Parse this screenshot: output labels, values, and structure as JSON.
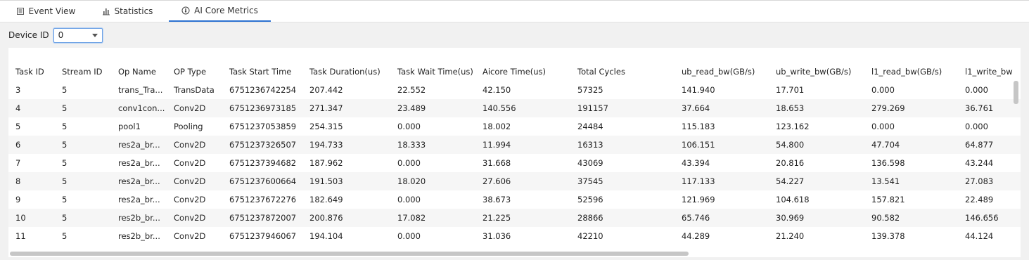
{
  "tabs": [
    {
      "label": "Event View",
      "icon": "list-icon",
      "active": false
    },
    {
      "label": "Statistics",
      "icon": "bar-chart-icon",
      "active": false
    },
    {
      "label": "AI Core Metrics",
      "icon": "gauge-icon",
      "active": true
    }
  ],
  "device": {
    "label": "Device ID",
    "value": "0"
  },
  "table": {
    "columns": [
      "Task ID",
      "Stream ID",
      "Op Name",
      "OP Type",
      "Task Start Time",
      "Task Duration(us)",
      "Task Wait Time(us)",
      "Aicore Time(us)",
      "Total Cycles",
      "ub_read_bw(GB/s)",
      "ub_write_bw(GB/s)",
      "l1_read_bw(GB/s)",
      "l1_write_bw"
    ],
    "rows": [
      [
        "3",
        "5",
        "trans_Tra...",
        "TransData",
        "6751236742254",
        "207.442",
        "22.552",
        "42.150",
        "57325",
        "141.940",
        "17.701",
        "0.000",
        "0.000"
      ],
      [
        "4",
        "5",
        "conv1con...",
        "Conv2D",
        "6751236973185",
        "271.347",
        "23.489",
        "140.556",
        "191157",
        "37.664",
        "18.653",
        "279.269",
        "36.761"
      ],
      [
        "5",
        "5",
        "pool1",
        "Pooling",
        "6751237053859",
        "254.315",
        "0.000",
        "18.002",
        "24484",
        "115.183",
        "123.162",
        "0.000",
        "0.000"
      ],
      [
        "6",
        "5",
        "res2a_br...",
        "Conv2D",
        "6751237326507",
        "194.733",
        "18.333",
        "11.994",
        "16313",
        "106.151",
        "54.800",
        "47.704",
        "64.877"
      ],
      [
        "7",
        "5",
        "res2a_br...",
        "Conv2D",
        "6751237394682",
        "187.962",
        "0.000",
        "31.668",
        "43069",
        "43.394",
        "20.816",
        "136.598",
        "43.244"
      ],
      [
        "8",
        "5",
        "res2a_br...",
        "Conv2D",
        "6751237600664",
        "191.503",
        "18.020",
        "27.606",
        "37545",
        "117.133",
        "54.227",
        "13.541",
        "27.083"
      ],
      [
        "9",
        "5",
        "res2a_br...",
        "Conv2D",
        "6751237672276",
        "182.649",
        "0.000",
        "38.673",
        "52596",
        "121.969",
        "104.618",
        "157.821",
        "22.489"
      ],
      [
        "10",
        "5",
        "res2b_br...",
        "Conv2D",
        "6751237872007",
        "200.876",
        "17.082",
        "21.225",
        "28866",
        "65.746",
        "30.969",
        "90.582",
        "146.656"
      ],
      [
        "11",
        "5",
        "res2b_br...",
        "Conv2D",
        "6751237946067",
        "194.104",
        "0.000",
        "31.036",
        "42210",
        "44.289",
        "21.240",
        "139.378",
        "44.124"
      ]
    ]
  }
}
